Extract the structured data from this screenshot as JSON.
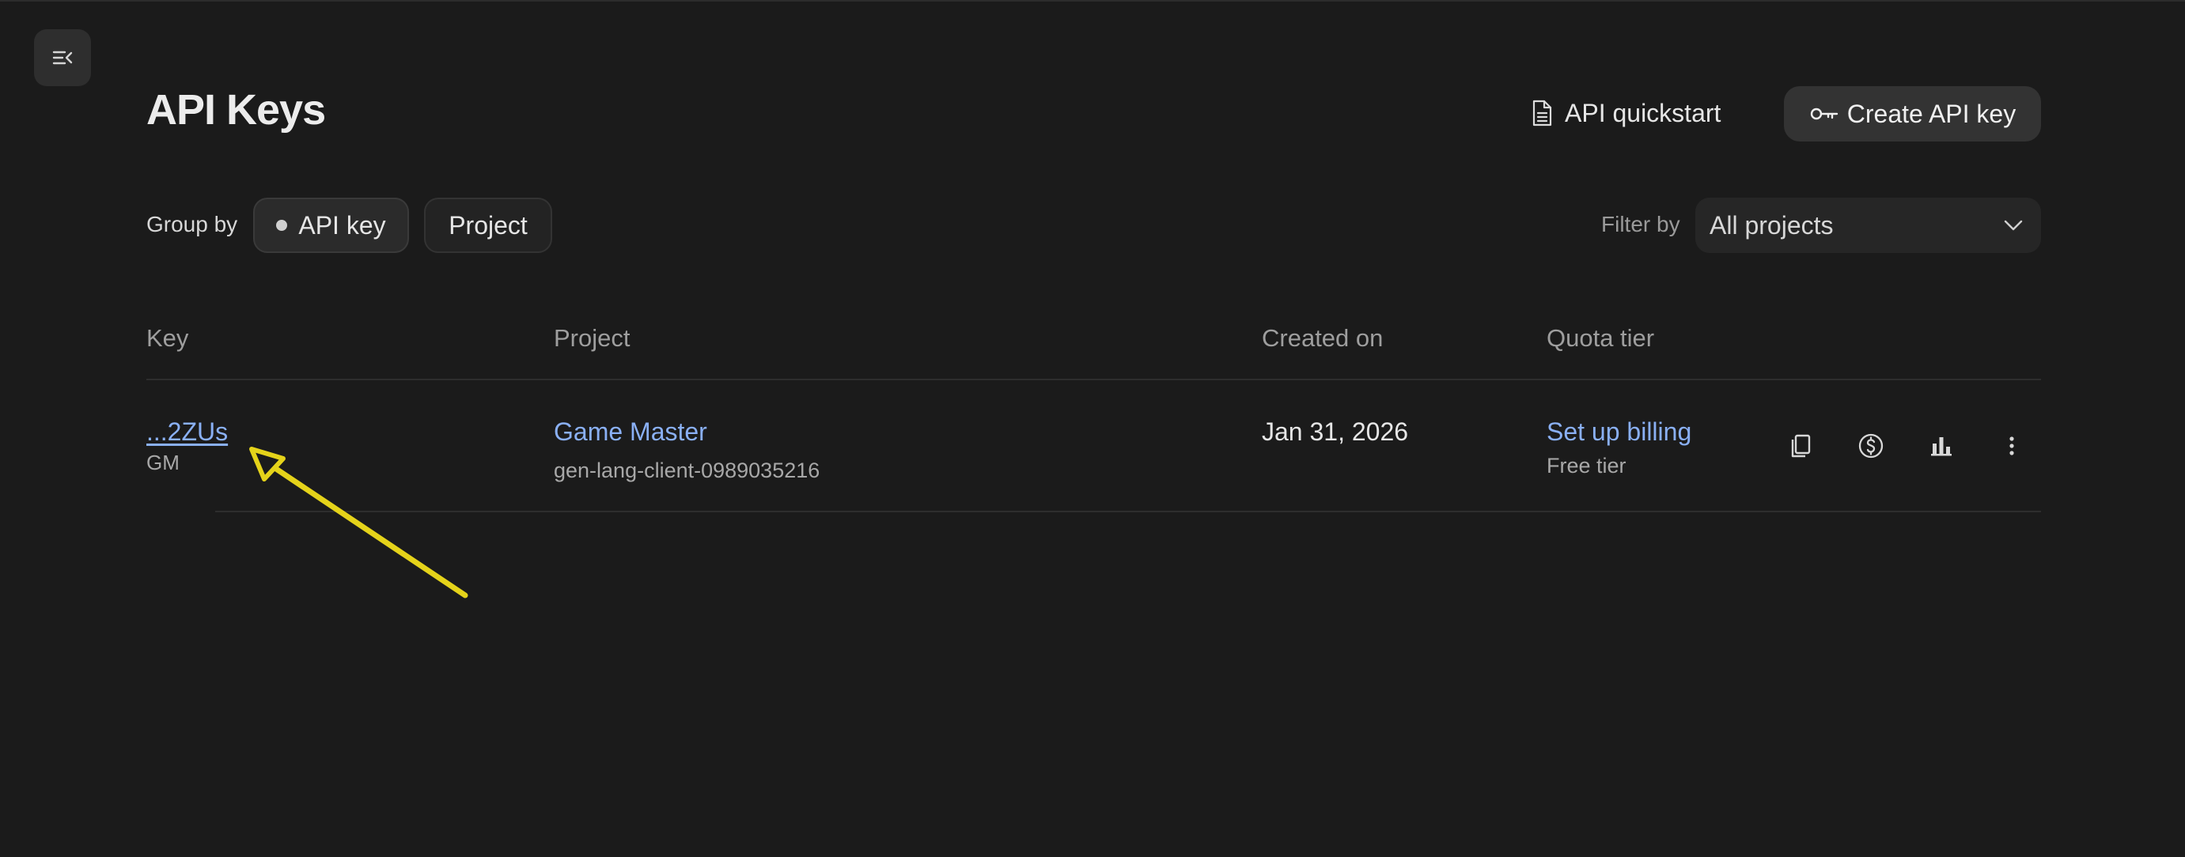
{
  "header": {
    "title": "API Keys",
    "quickstart_label": "API quickstart",
    "create_label": "Create API key"
  },
  "toolbar": {
    "group_by_label": "Group by",
    "group_options": [
      "API key",
      "Project"
    ],
    "group_selected": "API key",
    "filter_by_label": "Filter by",
    "filter_value": "All projects"
  },
  "table": {
    "columns": [
      "Key",
      "Project",
      "Created on",
      "Quota tier"
    ],
    "rows": [
      {
        "key": "...2ZUs",
        "key_name": "GM",
        "project_name": "Game Master",
        "project_id": "gen-lang-client-0989035216",
        "created_on": "Jan 31, 2026",
        "billing_link": "Set up billing",
        "tier": "Free tier"
      }
    ]
  },
  "icons": {
    "sidebar_toggle": "collapse-menu-icon",
    "quickstart": "document-icon",
    "create": "key-icon",
    "filter_chevron": "chevron-down-icon",
    "row_actions": [
      "copy-icon",
      "dollar-icon",
      "bar-chart-icon",
      "more-vertical-icon"
    ]
  },
  "colors": {
    "background": "#1b1b1b",
    "link": "#8ab0f5",
    "annotation_arrow": "#e5d31a"
  }
}
